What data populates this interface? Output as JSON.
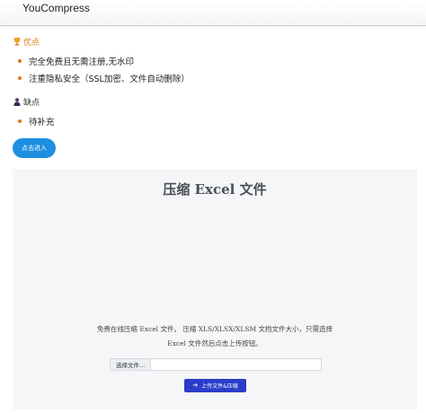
{
  "header": {
    "site_name": "YouCompress"
  },
  "pros": {
    "heading": "优点",
    "icon": "trophy-icon",
    "items": [
      "完全免费且无需注册,无水印",
      "注重隐私安全（SSL加密、文件自动删除）"
    ]
  },
  "cons": {
    "heading": "缺点",
    "icon": "person-icon",
    "items": [
      "待补充"
    ]
  },
  "enter_button": {
    "label": "点击进入"
  },
  "tool": {
    "title": "压缩 Excel 文件",
    "description_line1": "免费在线压缩 Excel 文件。 压缩 XLS/XLSX/XLSM 文档文件大小，只需选择",
    "description_line2": "Excel 文件然后点击上传按钮。",
    "choose_file_label": "选择文件...",
    "file_name_value": "",
    "upload_button_label": "上传文件&压缩",
    "upload_icon": "arrow-right-icon"
  },
  "colors": {
    "accent_orange": "#e07a10",
    "enter_button_blue": "#1d8fe0",
    "upload_button_blue": "#2a3cc9",
    "panel_background": "#f5f6f8"
  }
}
